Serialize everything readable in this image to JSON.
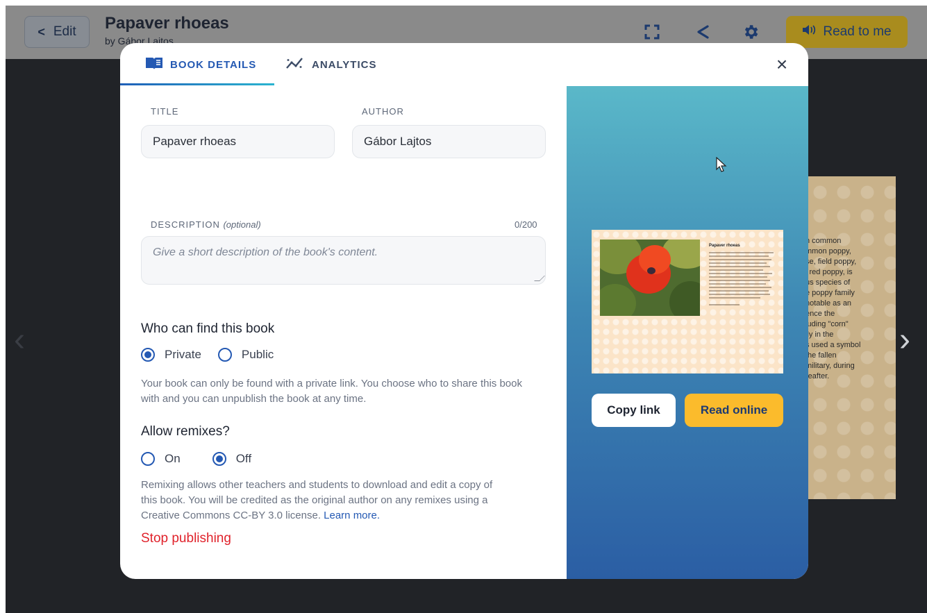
{
  "header": {
    "edit_label": "Edit",
    "book_title": "Papaver rhoeas",
    "book_byline": "by Gábor Lajtos",
    "read_to_me_label": "Read to me",
    "icons": [
      "fullscreen-icon",
      "share-icon",
      "gear-icon",
      "speaker-icon"
    ]
  },
  "modal": {
    "tabs": [
      {
        "label": "BOOK DETAILS",
        "icon": "book-open-icon",
        "active": true
      },
      {
        "label": "ANALYTICS",
        "icon": "analytics-icon",
        "active": false
      }
    ],
    "form": {
      "title_label": "TITLE",
      "title_value": "Papaver rhoeas",
      "author_label": "AUTHOR",
      "author_value": "Gábor Lajtos",
      "description_label": "DESCRIPTION",
      "description_optional": "(optional)",
      "description_counter": "0/200",
      "description_placeholder": "Give a short description of the book's content.",
      "visibility_heading": "Who can find this book",
      "visibility_options": [
        "Private",
        "Public"
      ],
      "visibility_selected": "Private",
      "visibility_help": "Your book can only be found with a private link. You choose who to share this book with and you can unpublish the book at any time.",
      "remix_heading": "Allow remixes?",
      "remix_options": [
        "On",
        "Off"
      ],
      "remix_selected": "Off",
      "remix_help": "Remixing allows other teachers and students to download and edit a copy of this book. You will be credited as the original author on any remixes using a Creative Commons CC-BY 3.0 license.",
      "remix_learn_more": "Learn more.",
      "stop_publishing": "Stop publishing"
    },
    "preview": {
      "copy_link_label": "Copy link",
      "read_online_label": "Read online",
      "mini_page_title": "Papaver rhoeas"
    }
  },
  "background_page": {
    "text": "h common\nmmon poppy,\nse, field poppy,\nl red poppy, is\nus species of\ne poppy family\nnotable as an\nence the\nluding \"corn\"\nlly in the\ns used a symbol\nthe fallen\nmilitary, during\nreafter."
  },
  "colors": {
    "accent": "#2459b3",
    "danger": "#e0222b",
    "read_button": "#fbbb2c",
    "overlay": "#212327"
  }
}
